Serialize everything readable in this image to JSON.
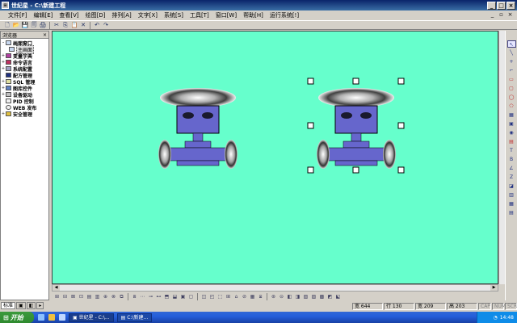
{
  "window": {
    "app_icon": "app-icon",
    "title": "世纪星 - C:\\新建工程",
    "minimize": "_",
    "maximize": "□",
    "close": "×"
  },
  "menu": {
    "items": [
      "文件[F]",
      "编辑[E]",
      "查看[V]",
      "绘图[D]",
      "排列[A]",
      "文字[X]",
      "系统[S]",
      "工具[T]",
      "窗口[W]",
      "帮助[H]",
      "运行系统[!]"
    ],
    "right_min": "_",
    "right_restore": "▫",
    "right_close": "×"
  },
  "toolbar": {
    "buttons": [
      "new-icon",
      "open-icon",
      "save-icon",
      "save-all-icon",
      "print-icon",
      "cut-icon",
      "copy-icon",
      "paste-icon",
      "delete-icon",
      "undo-icon",
      "redo-icon"
    ],
    "glyphs": [
      "🗋",
      "📂",
      "💾",
      "🗐",
      "🖨",
      "✂",
      "⎘",
      "📋",
      "✕",
      "↶",
      "↷"
    ]
  },
  "explorer": {
    "title": "浏览器",
    "close": "×",
    "tree": [
      {
        "label": "画面窗口",
        "expander": "-",
        "icon": "window-icon",
        "depth": 0
      },
      {
        "label": "主画面",
        "expander": "",
        "icon": "page-icon",
        "depth": 1
      },
      {
        "label": "变量字典",
        "expander": "+",
        "icon": "dictionary-icon",
        "depth": 0
      },
      {
        "label": "命令语言",
        "expander": "+",
        "icon": "command-icon",
        "depth": 0
      },
      {
        "label": "系统配置",
        "expander": "+",
        "icon": "config-icon",
        "depth": 0
      },
      {
        "label": "配方管理",
        "expander": "",
        "icon": "recipe-icon",
        "depth": 0
      },
      {
        "label": "SQL 管理",
        "expander": "+",
        "icon": "sql-icon",
        "depth": 0
      },
      {
        "label": "图库控件",
        "expander": "+",
        "icon": "library-icon",
        "depth": 0
      },
      {
        "label": "设备驱动",
        "expander": "+",
        "icon": "driver-icon",
        "depth": 0
      },
      {
        "label": "PID 控制",
        "expander": "",
        "icon": "pid-icon",
        "depth": 0
      },
      {
        "label": "WEB 发布",
        "expander": "",
        "icon": "web-icon",
        "depth": 0
      },
      {
        "label": "安全管理",
        "expander": "+",
        "icon": "security-icon",
        "depth": 0
      }
    ],
    "tabs": [
      "标准",
      "▣",
      "◧",
      "▸"
    ]
  },
  "canvas": {
    "background": "#66ffcc",
    "robot_body_color": "#6666cc",
    "robots": [
      {
        "name": "valve-robot-left",
        "selected": false
      },
      {
        "name": "valve-robot-right",
        "selected": true
      }
    ]
  },
  "right_toolbox": {
    "tools": [
      "pointer-icon",
      "line-icon",
      "plus-icon",
      "polyline-icon",
      "rect-icon",
      "rounded-rect-icon",
      "ellipse-icon",
      "polygon-icon",
      "image-icon",
      "bitmap-icon",
      "button-icon",
      "text-box-icon",
      "text-icon",
      "bold-text-icon",
      "pipe-icon",
      "z-line-icon",
      "fill-icon",
      "chart-icon",
      "grid-icon",
      "table-icon"
    ],
    "glyphs": [
      "↖",
      "╲",
      "+",
      "⌐",
      "▭",
      "▢",
      "◯",
      "⬠",
      "▦",
      "▣",
      "◉",
      "▤",
      "T",
      "B",
      "∠",
      "Z",
      "◪",
      "▥",
      "▦",
      "▤"
    ]
  },
  "bottom_toolbar": {
    "glyphs": [
      "⊞",
      "⊟",
      "⊠",
      "⊡",
      "▤",
      "▥",
      "⊕",
      "⊗",
      "⧉",
      "⧈",
      "⋯",
      "⊸",
      "⊷",
      "⬒",
      "⬓",
      "▣",
      "▢",
      "◫",
      "◰",
      "⬚",
      "⊞",
      "⌂",
      "⊘",
      "▦",
      "⧆",
      "⊛",
      "⊝",
      "◧",
      "◨",
      "▧",
      "▨",
      "▩",
      "◩",
      "⬕"
    ]
  },
  "status": {
    "width_label": "宽 644",
    "height_label": "行 130",
    "x_label": "宽 209",
    "y_label": "高 203",
    "caps": "CAP",
    "num": "NUM",
    "scrl": "SCRL"
  },
  "taskbar": {
    "start_label": "开始",
    "task1": "世纪星 - C:\\...",
    "task2": "C:\\新建...",
    "clock": "14:48"
  }
}
